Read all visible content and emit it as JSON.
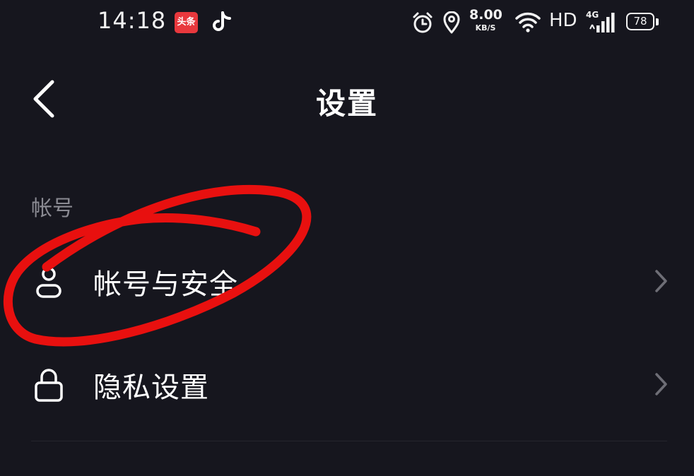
{
  "status_bar": {
    "time": "14:18",
    "news_app_label": "头条",
    "net_speed_value": "8.00",
    "net_speed_unit": "KB/S",
    "hd_label": "HD",
    "network_generation": "4G",
    "battery_level": "78",
    "icons": [
      "toutiao-app-icon",
      "tiktok-icon",
      "alarm-icon",
      "location-pin-icon",
      "wifi-icon",
      "signal-bars-icon",
      "battery-icon"
    ]
  },
  "header": {
    "title": "设置",
    "back_icon": "chevron-left-icon"
  },
  "sections": [
    {
      "title": "帐号",
      "items": [
        {
          "label": "帐号与安全",
          "icon": "user-icon"
        },
        {
          "label": "隐私设置",
          "icon": "lock-icon"
        }
      ]
    }
  ],
  "colors": {
    "background": "#16161e",
    "text": "#ffffff",
    "secondary_text": "#8a8a92",
    "chevron": "#6e6e76",
    "annotation": "#e8100f"
  }
}
